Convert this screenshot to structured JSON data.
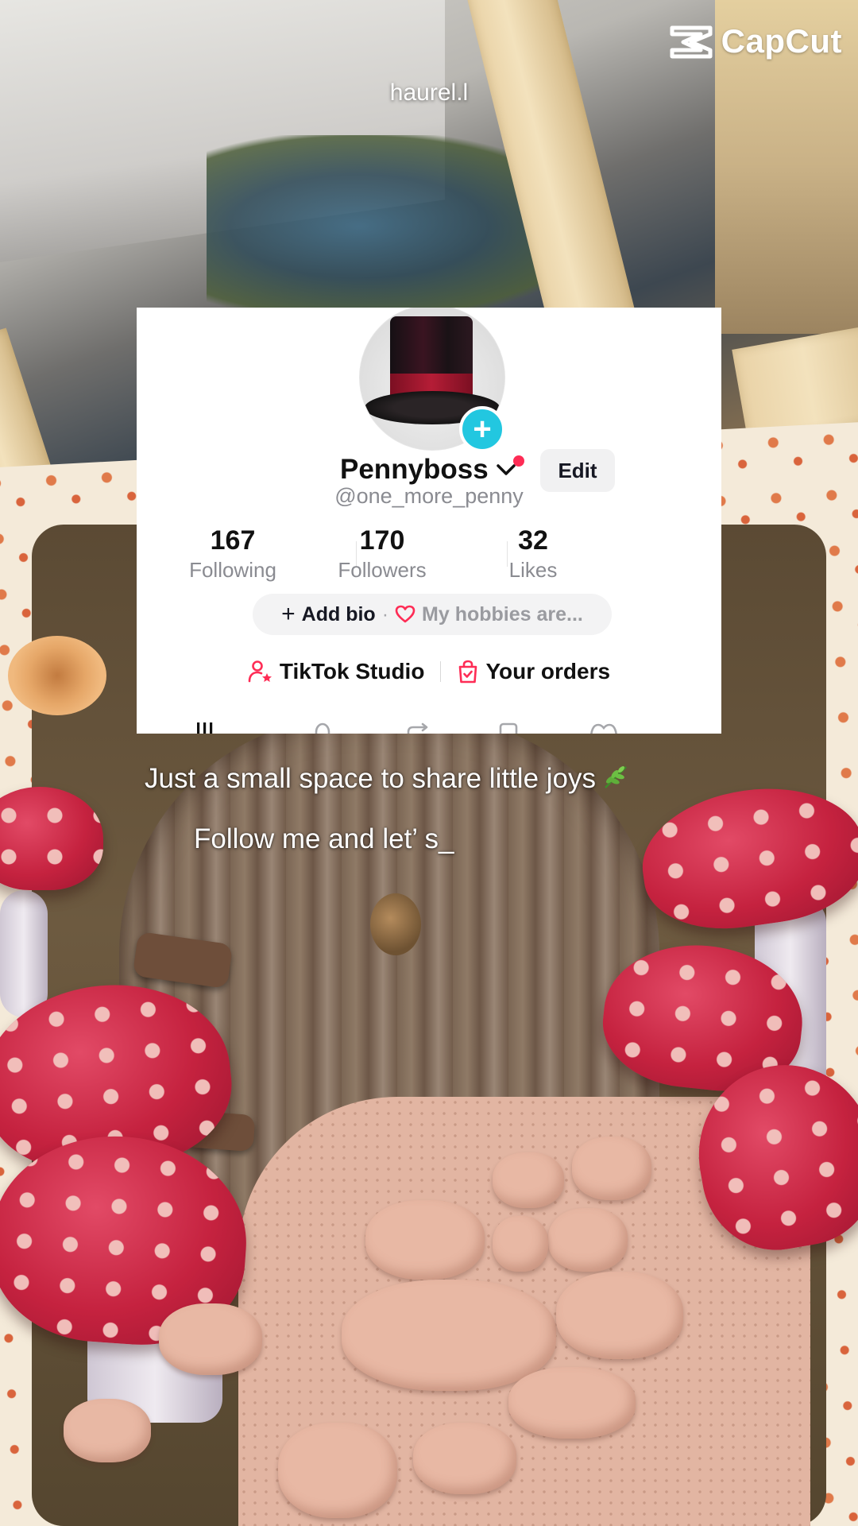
{
  "overlay": {
    "capcut_label": "CapCut",
    "top_username": "haurel.l"
  },
  "profile": {
    "display_name": "Pennyboss",
    "handle": "@one_more_penny",
    "edit_label": "Edit",
    "stats": [
      {
        "value": "167",
        "label": "Following"
      },
      {
        "value": "170",
        "label": "Followers"
      },
      {
        "value": "32",
        "label": "Likes"
      }
    ],
    "bio": {
      "add_label": "Add bio",
      "separator": "·",
      "placeholder": "My hobbies are..."
    },
    "links": {
      "studio_label": "TikTok Studio",
      "orders_label": "Your orders"
    },
    "tab_icons": [
      "grid-filter-icon",
      "lock-icon",
      "repost-icon",
      "bookmark-icon",
      "heart-icon"
    ]
  },
  "captions": {
    "line1": "Just a small space to share little joys",
    "line2": "Follow me and let’ s_"
  },
  "colors": {
    "accent_red": "#fe2c55",
    "plus_cyan": "#22c7e0",
    "card_bg": "#ffffff"
  }
}
